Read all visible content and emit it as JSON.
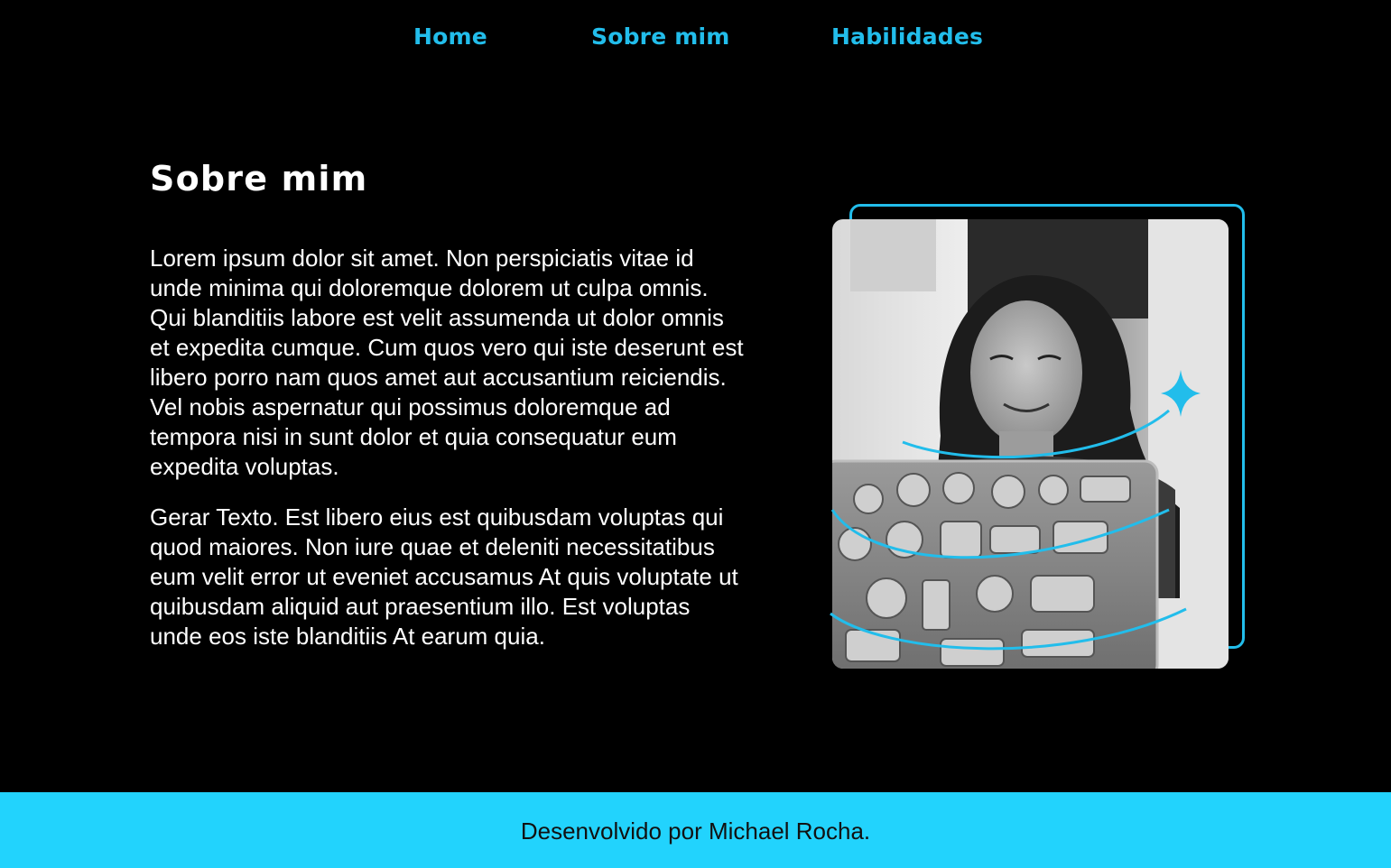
{
  "nav": {
    "items": [
      {
        "label": "Home"
      },
      {
        "label": "Sobre mim"
      },
      {
        "label": "Habilidades"
      }
    ]
  },
  "about": {
    "title": "Sobre mim",
    "paragraphs": [
      "Lorem ipsum dolor sit amet. Non perspiciatis vitae id unde minima qui doloremque dolorem ut culpa omnis. Qui blanditiis labore est velit assumenda ut dolor omnis et expedita cumque. Cum quos vero qui iste deserunt est libero porro nam quos amet aut accusantium reiciendis. Vel nobis aspernatur qui possimus doloremque ad tempora nisi in sunt dolor et quia consequatur eum expedita voluptas.",
      "Gerar Texto. Est libero eius est quibusdam voluptas qui quod maiores. Non iure quae et deleniti necessitatibus eum velit error ut eveniet accusamus At quis voluptate ut quibusdam aliquid aut praesentium illo. Est voluptas unde eos iste blanditiis At earum quia."
    ],
    "image_icon": "profile-photo-woman-with-laptop"
  },
  "footer": {
    "text": "Desenvolvido por Michael Rocha."
  },
  "colors": {
    "background": "#000000",
    "accent": "#22bdeb",
    "footer_bg": "#22d3fd",
    "text": "#ffffff"
  }
}
